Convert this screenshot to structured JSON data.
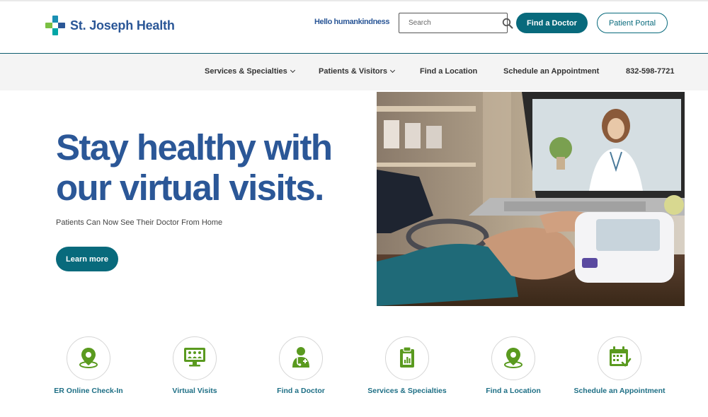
{
  "header": {
    "logo_text": "St. Joseph Health",
    "tagline": "Hello humankindness",
    "search_placeholder": "Search",
    "find_doctor_label": "Find a Doctor",
    "patient_portal_label": "Patient Portal"
  },
  "nav": {
    "items": [
      {
        "label": "Services & Specialties",
        "dropdown": true
      },
      {
        "label": "Patients & Visitors",
        "dropdown": true
      },
      {
        "label": "Find a Location",
        "dropdown": false
      },
      {
        "label": "Schedule an Appointment",
        "dropdown": false
      },
      {
        "label": "832-598-7721",
        "dropdown": false
      }
    ]
  },
  "hero": {
    "title": "Stay healthy with our virtual visits.",
    "subtitle": "Patients Can Now See Their Doctor From Home",
    "cta_label": "Learn more"
  },
  "quick_links": [
    {
      "label": "ER Online Check-In",
      "icon": "location-pin-icon"
    },
    {
      "label": "Virtual Visits",
      "icon": "video-conference-icon"
    },
    {
      "label": "Find a Doctor",
      "icon": "doctor-icon"
    },
    {
      "label": "Services & Specialties",
      "icon": "clipboard-chart-icon"
    },
    {
      "label": "Find a Location",
      "icon": "location-pin-icon"
    },
    {
      "label": "Schedule an Appointment",
      "icon": "calendar-check-icon"
    }
  ],
  "colors": {
    "brand_blue": "#2b5797",
    "teal": "#086a7c",
    "icon_green": "#5a9a1f",
    "nav_bg": "#f4f4f4"
  }
}
